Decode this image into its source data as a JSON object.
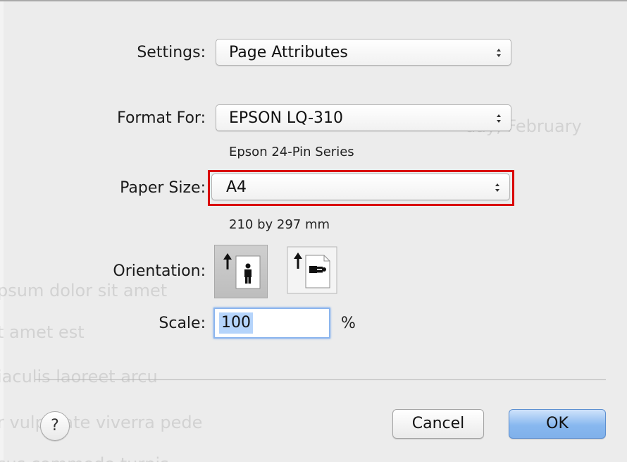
{
  "settings": {
    "label": "Settings:",
    "value": "Page Attributes"
  },
  "format_for": {
    "label": "Format For:",
    "value": "EPSON LQ-310",
    "description": "Epson 24-Pin Series"
  },
  "paper_size": {
    "label": "Paper Size:",
    "value": "A4",
    "dimensions": "210 by 297 mm",
    "highlight_color": "#d90000"
  },
  "orientation": {
    "label": "Orientation:",
    "options": [
      {
        "icon": "portrait-orientation-icon",
        "selected": true
      },
      {
        "icon": "landscape-orientation-icon",
        "selected": false
      }
    ]
  },
  "scale": {
    "label": "Scale:",
    "value": "100",
    "unit": "%"
  },
  "footer": {
    "help_label": "?",
    "cancel_label": "Cancel",
    "ok_label": "OK"
  },
  "background_text": [
    "psum dolor sit amet",
    "t amet est",
    "iaculis laoreet arcu",
    "r vulputate viverra pede",
    "sus commodo turpis",
    "day, February"
  ],
  "colors": {
    "dialog_bg": "#ececec",
    "ok_button": "#88b8ef",
    "focus_ring": "#8bb5ee"
  }
}
